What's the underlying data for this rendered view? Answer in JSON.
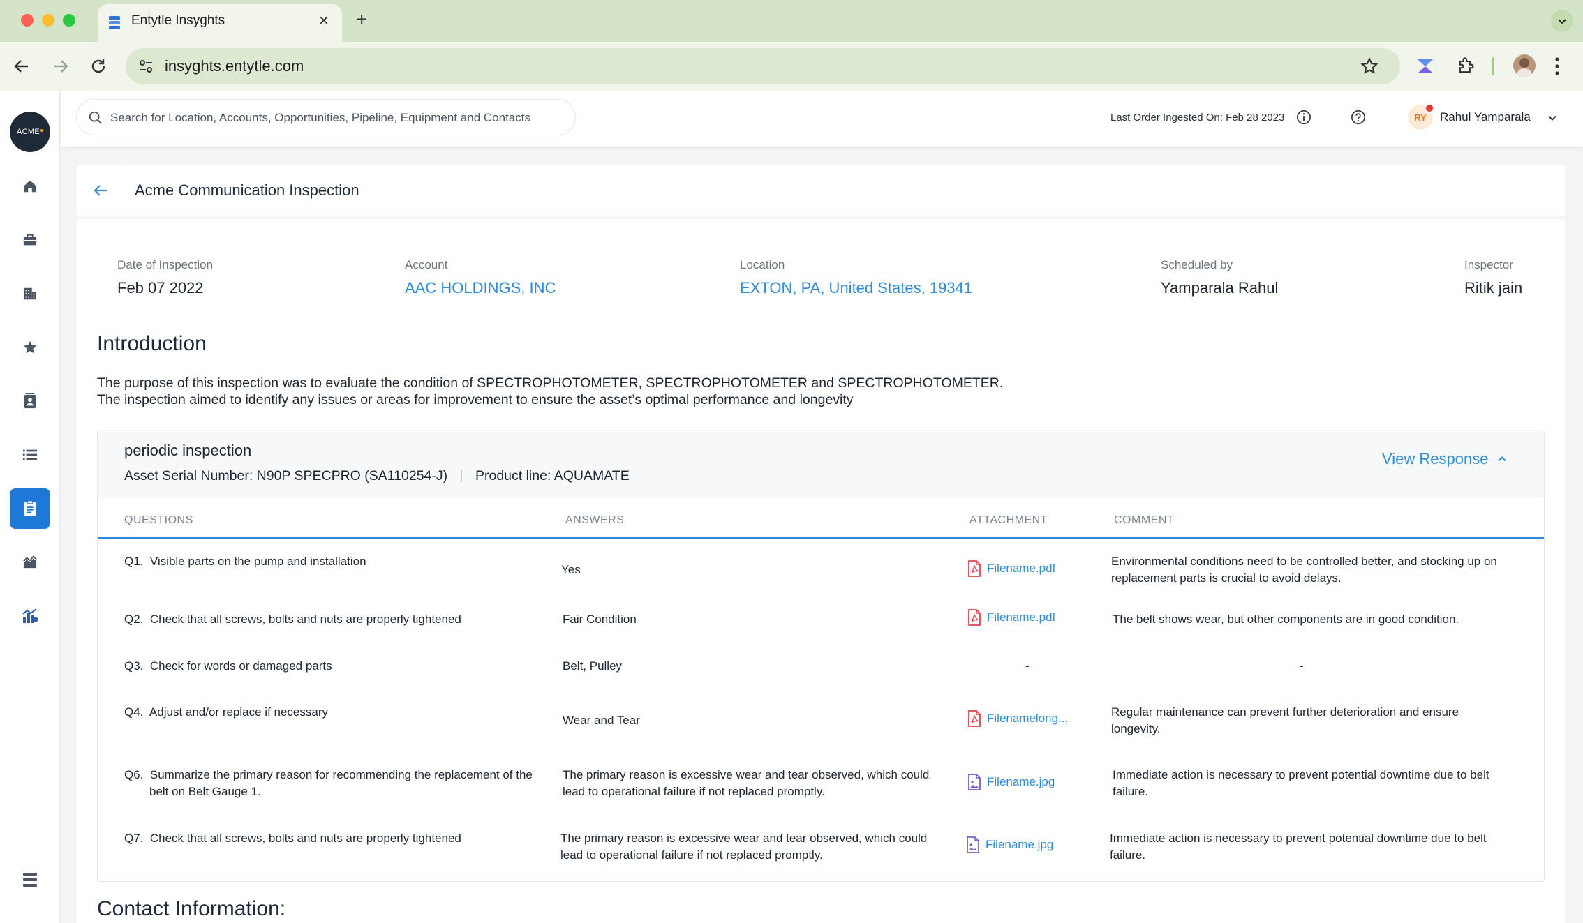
{
  "browser": {
    "tab_title": "Entytle Insyghts",
    "url": "insyghts.entytle.com",
    "new_tab_symbol": "+",
    "close_symbol": "✕"
  },
  "sidebar": {
    "logo_text": "ACME",
    "items": [
      {
        "icon": "home-icon"
      },
      {
        "icon": "briefcase-icon"
      },
      {
        "icon": "building-icon"
      },
      {
        "icon": "star-icon"
      },
      {
        "icon": "contacts-icon"
      },
      {
        "icon": "list-icon"
      },
      {
        "icon": "clipboard-icon",
        "active": true
      },
      {
        "icon": "pipeline-icon"
      },
      {
        "icon": "reports-icon"
      },
      {
        "icon": "menu-icon"
      }
    ]
  },
  "topbar": {
    "search_placeholder": "Search for Location, Accounts, Opportunities, Pipeline, Equipment and Contacts",
    "last_order": "Last Order Ingested On: Feb 28 2023",
    "user_initials": "RY",
    "user_name": "Rahul Yamparala"
  },
  "page": {
    "title": "Acme Communication Inspection"
  },
  "meta": {
    "date_label": "Date of Inspection",
    "date_value": "Feb 07 2022",
    "account_label": "Account",
    "account_value": "AAC HOLDINGS, INC",
    "location_label": "Location",
    "location_value": "EXTON, PA, United States, 19341",
    "scheduled_label": "Scheduled by",
    "scheduled_value": "Yamparala Rahul",
    "inspector_label": "Inspector",
    "inspector_value": "Ritik jain"
  },
  "intro": {
    "title": "Introduction",
    "line1": "The purpose of this inspection was to evaluate the condition of SPECTROPHOTOMETER, SPECTROPHOTOMETER and SPECTROPHOTOMETER.",
    "line2": "The inspection aimed to identify any issues or areas for improvement to ensure the asset’s optimal performance and longevity"
  },
  "panel": {
    "title": "periodic inspection",
    "asset": "Asset Serial Number: N90P SPECPRO (SA110254-J)",
    "product_line": "Product line: AQUAMATE",
    "view_response": "View Response",
    "columns": {
      "questions": "QUESTIONS",
      "answers": "ANSWERS",
      "attachment": "ATTACHMENT",
      "comment": "COMMENT"
    },
    "rows": [
      {
        "q_num": "Q1.",
        "q": "Visible parts on the pump and installation",
        "a": "Yes",
        "file": "Filename.pdf",
        "file_type": "pdf",
        "comment": "Environmental conditions need to be controlled better, and stocking up on replacement parts is crucial to avoid delays."
      },
      {
        "q_num": "Q2.",
        "q": "Check that all screws, bolts and nuts are properly tightened",
        "a": "Fair Condition",
        "file": "Filename.pdf",
        "file_type": "pdf",
        "comment": "The belt shows wear, but other components are in good condition."
      },
      {
        "q_num": "Q3.",
        "q": "Check for words or damaged parts",
        "a": "Belt, Pulley",
        "file": "-",
        "file_type": "none",
        "comment": "-"
      },
      {
        "q_num": "Q4.",
        "q": "Adjust and/or replace if necessary",
        "a": "Wear and Tear",
        "file": "Filenamelong...",
        "file_type": "pdf",
        "comment": "Regular maintenance can prevent further deterioration and ensure longevity."
      },
      {
        "q_num": "Q6.",
        "q": "Summarize the primary reason for recommending the replacement of the belt on Belt Gauge 1.",
        "a": "The primary reason is excessive wear and tear observed, which could lead to operational failure if not replaced promptly.",
        "file": "Filename.jpg",
        "file_type": "jpg",
        "comment": "Immediate action is necessary to prevent potential downtime due to belt failure."
      },
      {
        "q_num": "Q7.",
        "q": "Check that all screws, bolts and nuts are properly tightened",
        "a": "The primary reason is excessive wear and tear observed, which could lead to operational failure if not replaced promptly.",
        "file": "Filename.jpg",
        "file_type": "jpg",
        "comment": "Immediate action is necessary to prevent potential downtime due to belt failure."
      }
    ]
  },
  "contact": {
    "title": "Contact Information:"
  },
  "colors": {
    "accent": "#1d78d8",
    "link": "#2f8bd8",
    "pdf": "#e0434b",
    "jpg": "#7a5fc4"
  }
}
